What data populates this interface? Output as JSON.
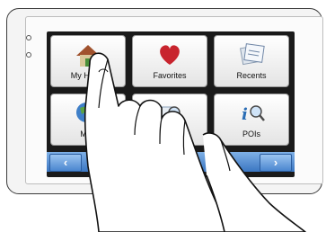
{
  "screen": {
    "tiles": [
      {
        "label": "My Home",
        "icon": "house-icon"
      },
      {
        "label": "Favorites",
        "icon": "heart-icon"
      },
      {
        "label": "Recents",
        "icon": "papers-icon"
      },
      {
        "label": "Map",
        "icon": "globe-icon"
      },
      {
        "label": "",
        "icon": "map-search-icon"
      },
      {
        "label": "POIs",
        "icon": "poi-search-icon"
      }
    ],
    "nav": {
      "prev": "‹",
      "next": "›"
    }
  },
  "colors": {
    "nav_bar": "#3a76c2",
    "heart": "#c8242e",
    "bezel": "#f4f4f4"
  }
}
